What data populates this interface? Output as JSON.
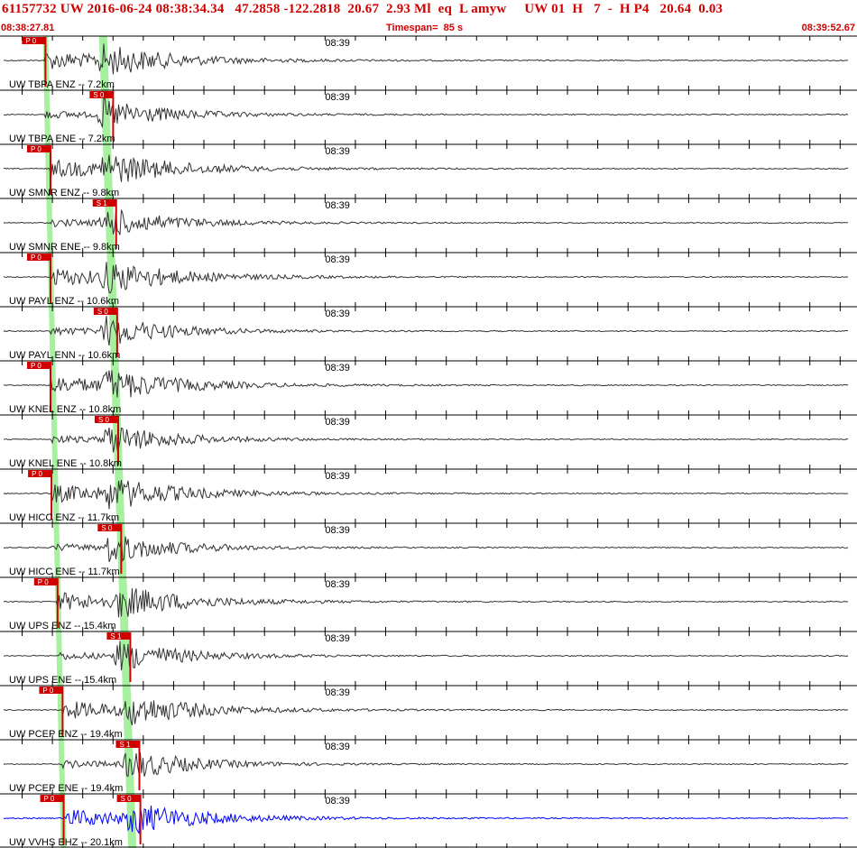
{
  "header": {
    "title": "61157732 UW 2016-06-24 08:38:34.34   47.2858 -122.2818  20.67  2.93 Ml  eq  L amyw     UW 01  H   7  -  H P4   20.64  0.03",
    "start_time": "08:38:27.81",
    "timespan": "Timespan=  85 s",
    "end_time": "08:39:52.67"
  },
  "minute_label": "08:39",
  "colors": {
    "accent": "#d00000",
    "trace": "#333333",
    "selected_trace": "#0000ff",
    "pick_band": "#a6f0a0"
  },
  "traces": [
    {
      "label": "UW TBPA ENZ -- 7.2km",
      "pick": "P 0",
      "p_time": 4.5,
      "s_time": 11.0
    },
    {
      "label": "UW TBPA ENE -- 7.2km",
      "pick": "S 0",
      "p_time": 4.5,
      "s_time": 11.0
    },
    {
      "label": "UW SMNR ENZ -- 9.8km",
      "pick": "P 0",
      "p_time": 5.0,
      "s_time": 11.3
    },
    {
      "label": "UW SMNR ENE -- 9.8km",
      "pick": "S 1",
      "p_time": 5.0,
      "s_time": 11.3
    },
    {
      "label": "UW PAYL ENZ -- 10.6km",
      "pick": "P 0",
      "p_time": 5.0,
      "s_time": 11.4
    },
    {
      "label": "UW PAYL ENN -- 10.6km",
      "pick": "S 0",
      "p_time": 5.0,
      "s_time": 11.4
    },
    {
      "label": "UW KNEL ENZ -- 10.8km",
      "pick": "P 0",
      "p_time": 5.0,
      "s_time": 11.5
    },
    {
      "label": "UW KNEL ENE -- 10.8km",
      "pick": "S 0",
      "p_time": 5.0,
      "s_time": 11.5
    },
    {
      "label": "UW HICC ENZ -- 11.7km",
      "pick": "P 0",
      "p_time": 5.1,
      "s_time": 11.8
    },
    {
      "label": "UW HICC ENE -- 11.7km",
      "pick": "S 0",
      "p_time": 5.1,
      "s_time": 11.8
    },
    {
      "label": "UW UPS ENZ -- 15.4km",
      "pick": "P 0",
      "p_time": 5.7,
      "s_time": 12.7
    },
    {
      "label": "UW UPS ENE -- 15.4km",
      "pick": "S 1",
      "p_time": 5.7,
      "s_time": 12.7
    },
    {
      "label": "UW PCEP ENZ -- 19.4km",
      "pick": "P 0",
      "p_time": 6.2,
      "s_time": 13.6
    },
    {
      "label": "UW PCEP ENE -- 19.4km",
      "pick": "S 1",
      "p_time": 6.2,
      "s_time": 13.6
    },
    {
      "label": "UW VVHS EHZ -- 20.1km",
      "pick": "P 0",
      "pick2": "S 0",
      "p_time": 6.3,
      "s_time": 13.9,
      "selected": true
    }
  ]
}
